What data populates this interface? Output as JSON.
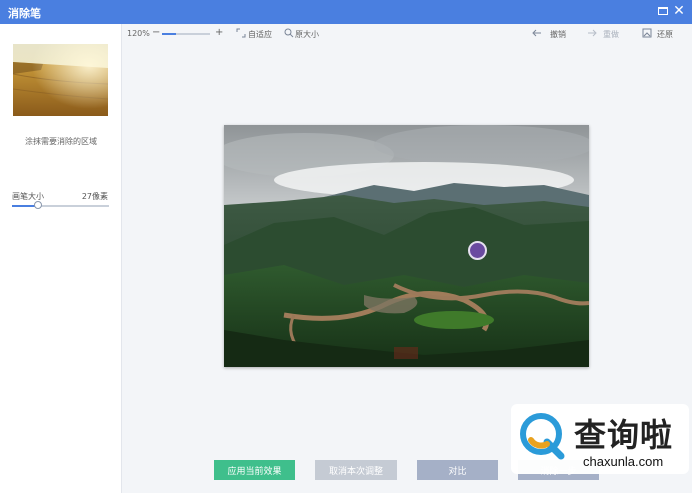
{
  "window": {
    "title": "消除笔",
    "colors": {
      "titlebar": "#4a7fe0",
      "accent": "#4a7fe0",
      "apply": "#3fbf8c"
    }
  },
  "sidebar": {
    "hint": "涂抹需要消除的区域",
    "brush_label": "画笔大小",
    "brush_value": "27像素",
    "brush_level": 0.27
  },
  "toolbar": {
    "zoom_value": "120%",
    "zoom_level": 0.3,
    "fit_label": "自适应",
    "original_label": "原大小",
    "undo_label": "撤销",
    "redo_label": "重做",
    "restore_label": "还原"
  },
  "actions": {
    "apply_label": "应用当前效果",
    "cancel_label": "取消本次调整",
    "compare_label": "对比",
    "last_label": "消除一步"
  },
  "watermark": {
    "text": "查询啦",
    "url": "chaxunla.com"
  }
}
